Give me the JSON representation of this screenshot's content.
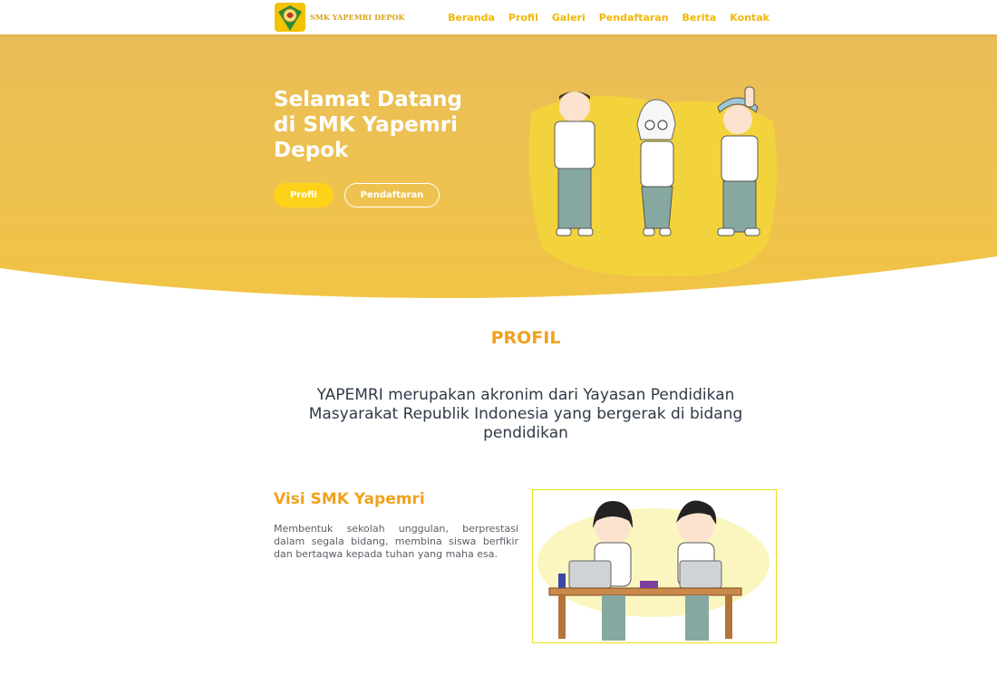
{
  "brand": {
    "name": "SMK YAPEMRI DEPOK",
    "logo_icon": "school-crest-icon"
  },
  "nav": {
    "items": [
      "Beranda",
      "Profil",
      "Galeri",
      "Pendaftaran",
      "Berita",
      "Kontak"
    ]
  },
  "hero": {
    "title": "Selamat Datang di SMK Yapemri Depok",
    "buttons": {
      "primary": "Profil",
      "secondary": "Pendaftaran"
    }
  },
  "profile": {
    "heading": "PROFIL",
    "description": "YAPEMRI merupakan akronim dari Yayasan Pendidikan Masyarakat Republik Indonesia yang bergerak di bidang pendidikan",
    "visi": {
      "title": "Visi SMK Yapemri",
      "text": "Membentuk sekolah unggulan, berprestasi dalam segala bidang, membina siswa berfikir dan bertaqwa kepada tuhan yang maha esa."
    }
  },
  "colors": {
    "accent": "#f0a21e",
    "hero_bg": "#eec24f",
    "nav_link": "#f2b705",
    "button": "#ffd21a"
  }
}
